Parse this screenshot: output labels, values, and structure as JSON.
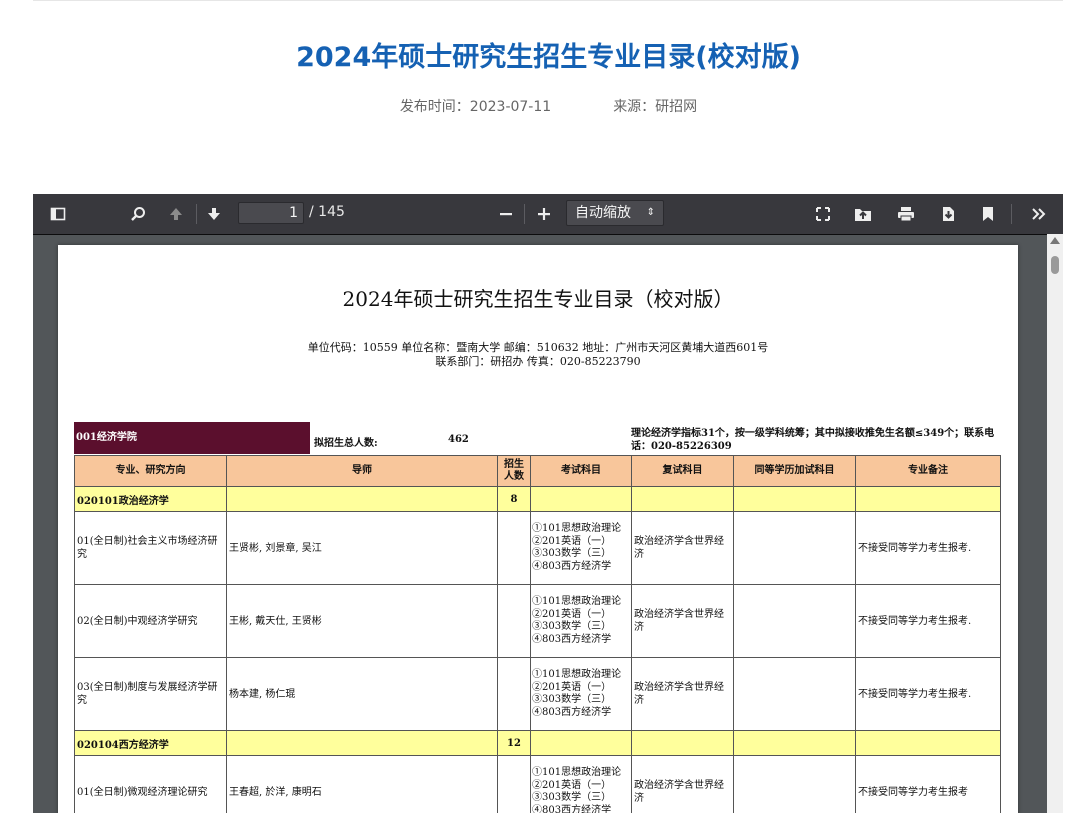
{
  "article": {
    "title": "2024年硕士研究生招生专业目录(校对版)",
    "publish_time": "发布时间：2023-07-11",
    "source": "来源：研招网"
  },
  "viewer": {
    "page_current": "1",
    "page_total": "/ 145",
    "zoom": "自动缩放",
    "icons": [
      "sidebar-toggle-icon",
      "search-icon",
      "previous-page-icon",
      "next-page-icon",
      "zoom-out-icon",
      "zoom-in-icon",
      "presentation-mode-icon",
      "open-file-icon",
      "print-icon",
      "download-icon",
      "bookmark-icon",
      "tools-icon"
    ]
  },
  "document": {
    "title": "2024年硕士研究生招生专业目录（校对版）",
    "info_line1": "单位代码：10559   单位名称：暨南大学   邮编：510632   地址：广州市天河区黄埔大道西601号",
    "info_line2": "联系部门：研招办   传真：020-85223790",
    "college": "001经济学院",
    "total_label": "拟招生总人数:",
    "total_value": "462",
    "college_note": "理论经济学指标31个，按一级学科统筹；其中拟接收推免生名额≤349个；联系电话：020-85226309",
    "headers": [
      "专业、研究方向",
      "导师",
      "招生人数",
      "考试科目",
      "复试科目",
      "同等学历加试科目",
      "专业备注"
    ],
    "rows": [
      {
        "type": "major",
        "name": "020101政治经济学",
        "count": "8"
      },
      {
        "type": "dir",
        "direction": "01(全日制)社会主义市场经济研究",
        "tutors": "王贤彬, 刘景章, 吴江",
        "exams": [
          "①101思想政治理论",
          "②201英语（一）",
          "③303数学（三）",
          "④803西方经济学"
        ],
        "retest": "政治经济学含世界经济",
        "remark": "不接受同等学力考生报考."
      },
      {
        "type": "dir",
        "direction": "02(全日制)中观经济学研究",
        "tutors": "王彬, 戴天仕, 王贤彬",
        "exams": [
          "①101思想政治理论",
          "②201英语（一）",
          "③303数学（三）",
          "④803西方经济学"
        ],
        "retest": "政治经济学含世界经济",
        "remark": "不接受同等学力考生报考."
      },
      {
        "type": "dir",
        "direction": "03(全日制)制度与发展经济学研究",
        "tutors": "杨本建, 杨仁琨",
        "exams": [
          "①101思想政治理论",
          "②201英语（一）",
          "③303数学（三）",
          "④803西方经济学"
        ],
        "retest": "政治经济学含世界经济",
        "remark": "不接受同等学力考生报考."
      },
      {
        "type": "major",
        "name": "020104西方经济学",
        "count": "12"
      },
      {
        "type": "dir",
        "direction": "01(全日制)微观经济理论研究",
        "tutors": "王春超, 於洋, 康明石",
        "exams": [
          "①101思想政治理论",
          "②201英语（一）",
          "③303数学（三）",
          "④803西方经济学"
        ],
        "retest": "政治经济学含世界经济",
        "remark": "不接受同等学力考生报考"
      }
    ]
  }
}
